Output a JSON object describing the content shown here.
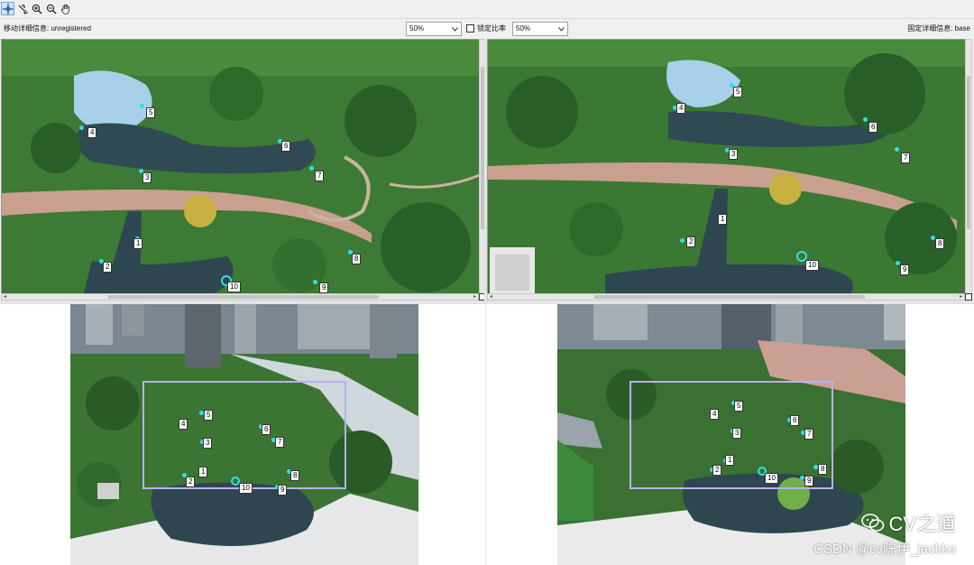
{
  "toolbar": {
    "tools": [
      {
        "name": "select-points-tool",
        "active": true
      },
      {
        "name": "add-point-tool",
        "active": false
      },
      {
        "name": "zoom-in-tool",
        "active": false
      },
      {
        "name": "zoom-out-tool",
        "active": false
      },
      {
        "name": "pan-tool",
        "active": false
      }
    ]
  },
  "moving": {
    "detail_label": "移动详细信息: unregistered",
    "zoom_value": "50%"
  },
  "lock_ratio": {
    "label": "锁定比率",
    "checked": false
  },
  "fixed": {
    "detail_label": "固定详细信息: base",
    "zoom_value": "50%"
  },
  "control_points": {
    "moving_detail": [
      "1",
      "2",
      "3",
      "4",
      "5",
      "6",
      "7",
      "8",
      "9",
      "10"
    ],
    "fixed_detail": [
      "1",
      "2",
      "3",
      "4",
      "5",
      "6",
      "7",
      "8",
      "9",
      "10"
    ],
    "moving_overview": [
      "1",
      "2",
      "3",
      "4",
      "5",
      "6",
      "7",
      "8",
      "9",
      "10"
    ],
    "fixed_overview": [
      "1",
      "2",
      "3",
      "4",
      "5",
      "6",
      "7",
      "8",
      "9",
      "10"
    ]
  },
  "colors": {
    "point_marker": "#2de0e8",
    "roi_frame": "#b8b0f0",
    "active_tool": "#cce4f7"
  },
  "watermark": {
    "brand": "CV之道",
    "credit": "CSDN @cv陈伊_jackko"
  }
}
